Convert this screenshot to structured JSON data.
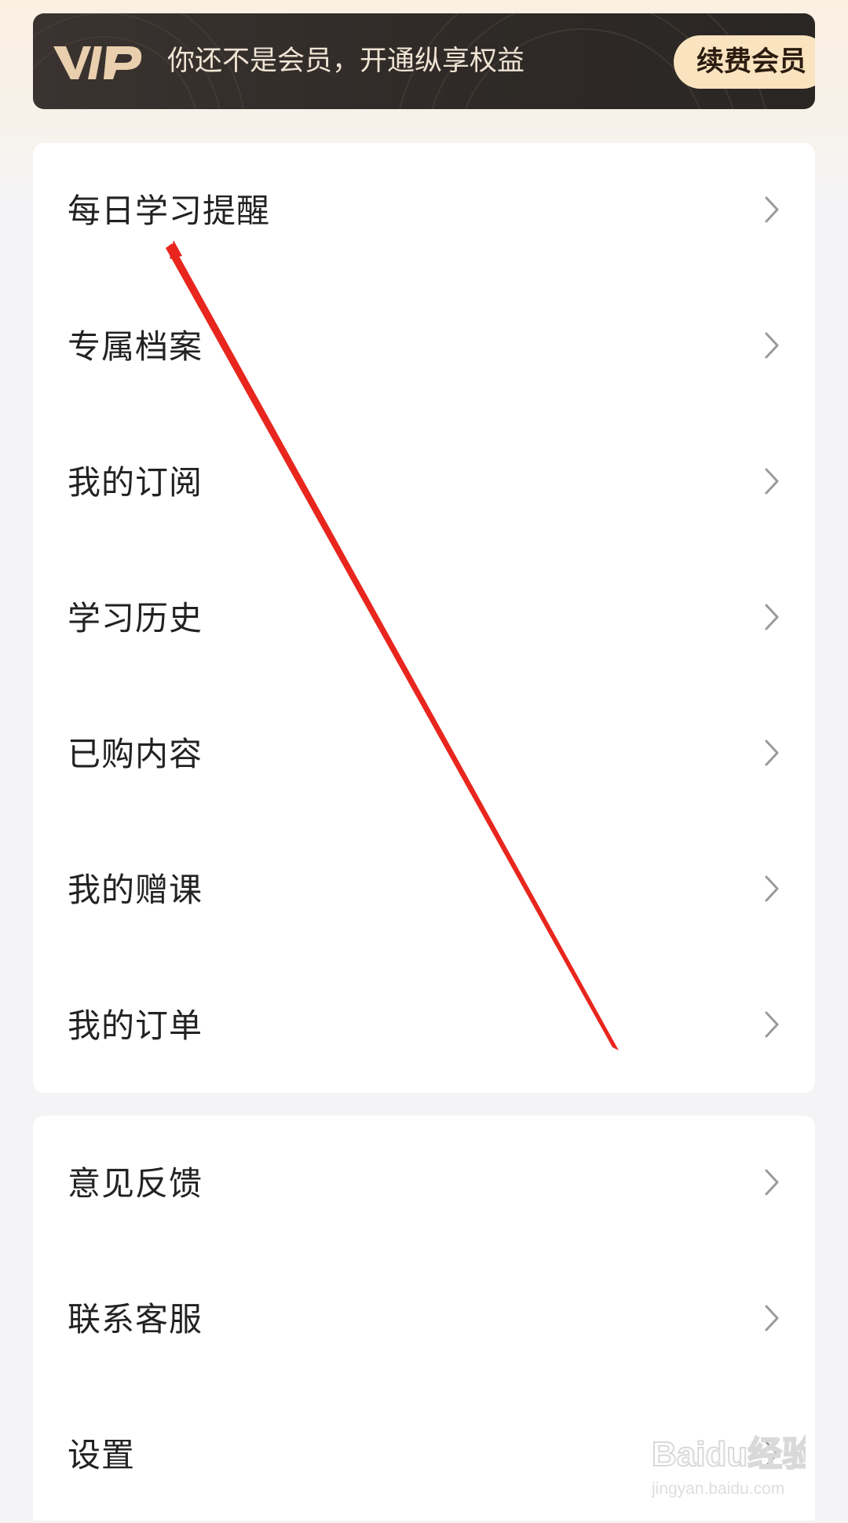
{
  "vip_banner": {
    "logo_text": "VIP",
    "message": "你还不是会员，开通纵享权益",
    "button_label": "续费会员"
  },
  "menu_group_1": {
    "items": [
      {
        "label": "每日学习提醒"
      },
      {
        "label": "专属档案"
      },
      {
        "label": "我的订阅"
      },
      {
        "label": "学习历史"
      },
      {
        "label": "已购内容"
      },
      {
        "label": "我的赠课"
      },
      {
        "label": "我的订单"
      }
    ]
  },
  "menu_group_2": {
    "items": [
      {
        "label": "意见反馈"
      },
      {
        "label": "联系客服"
      },
      {
        "label": "设置"
      }
    ]
  },
  "watermark": {
    "brand": "Baidu经验",
    "url": "jingyan.baidu.com"
  },
  "colors": {
    "banner_bg": "#2f2a27",
    "banner_text": "#efe3d3",
    "button_bg": "#fae3bf",
    "annotation_arrow": "#e8261d"
  },
  "icons": {
    "chevron": "chevron-right-icon",
    "annotation": "red-arrow-annotation"
  }
}
